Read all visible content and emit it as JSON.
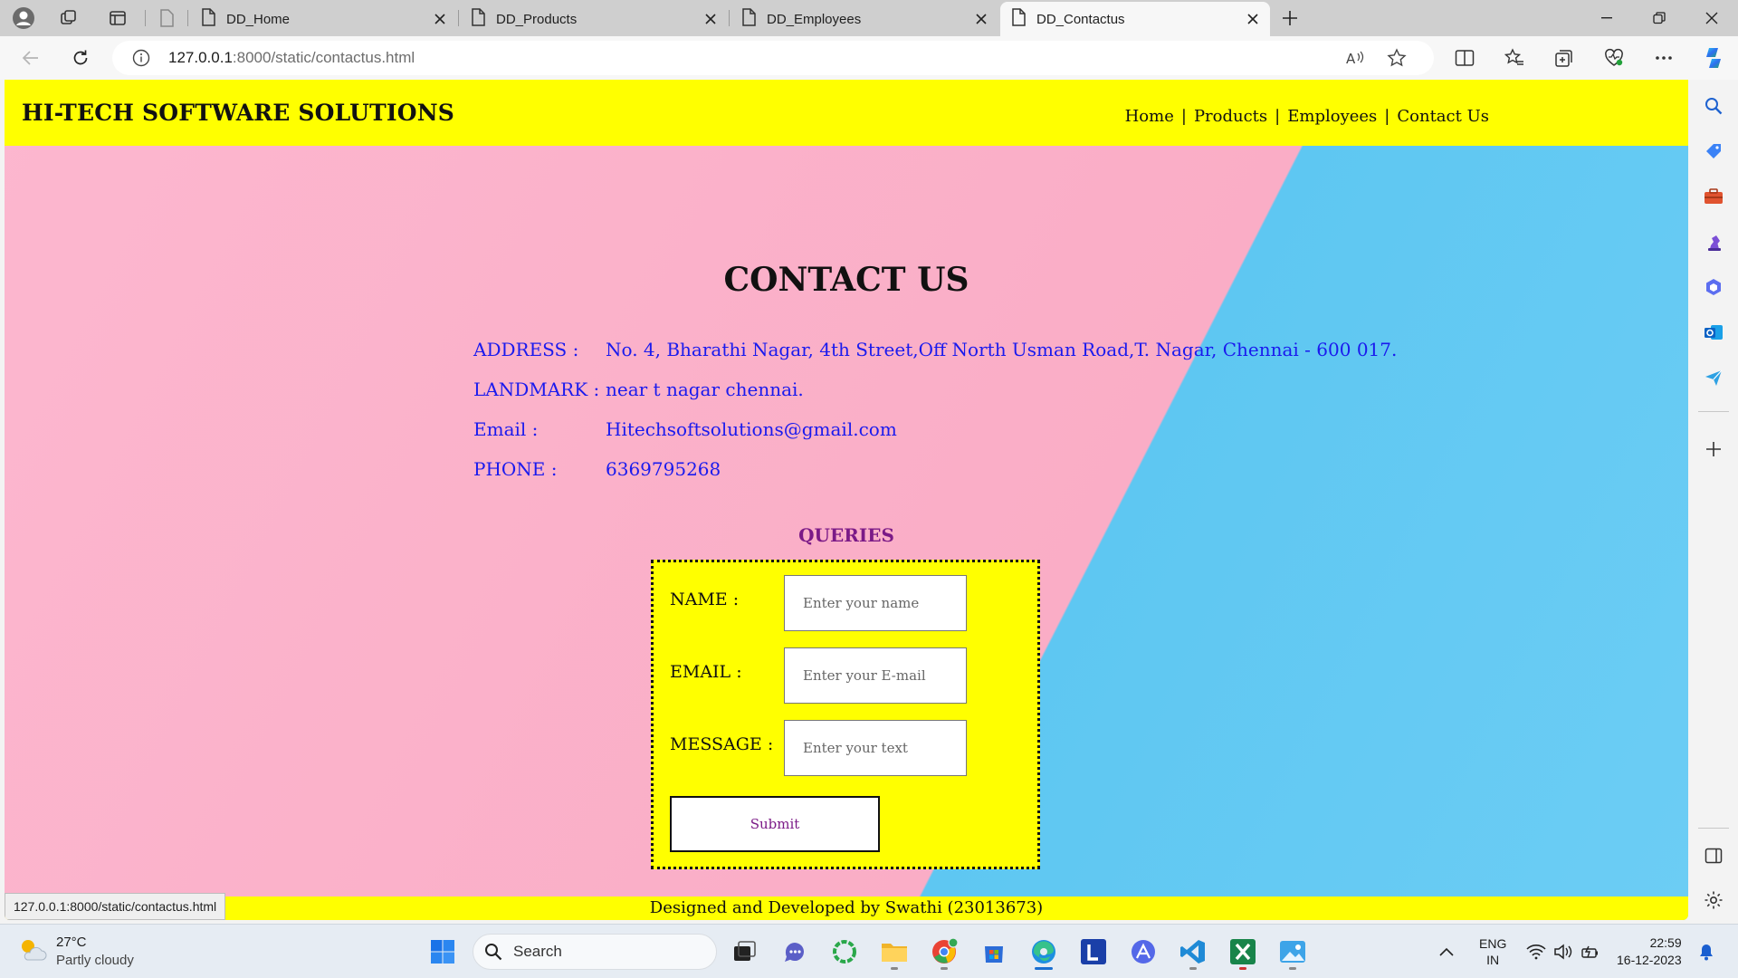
{
  "browser": {
    "tabs": [
      {
        "title": "DD_Home",
        "active": false
      },
      {
        "title": "DD_Products",
        "active": false
      },
      {
        "title": "DD_Employees",
        "active": false
      },
      {
        "title": "DD_Contactus",
        "active": true
      }
    ],
    "url_host": "127.0.0.1",
    "url_rest": ":8000/static/contactus.html",
    "status_url": "127.0.0.1:8000/static/contactus.html"
  },
  "site": {
    "brand": "HI-TECH SOFTWARE SOLUTIONS",
    "nav": {
      "home": "Home",
      "products": "Products",
      "employees": "Employees",
      "contact": "Contact Us",
      "sep": "|"
    },
    "page_title": "CONTACT US",
    "info": [
      {
        "label": "ADDRESS :",
        "value": "No. 4, Bharathi Nagar, 4th Street,Off North Usman Road,T. Nagar, Chennai - 600 017."
      },
      {
        "label": "LANDMARK :",
        "value": "near t nagar chennai."
      },
      {
        "label": "Email :",
        "value": "Hitechsoftsolutions@gmail.com"
      },
      {
        "label": "PHONE :",
        "value": "6369795268"
      }
    ],
    "queries_title": "QUERIES",
    "form": {
      "name_label": "NAME :",
      "name_placeholder": "Enter your name",
      "email_label": "EMAIL :",
      "email_placeholder": "Enter your E-mail",
      "message_label": "MESSAGE :",
      "message_placeholder": "Enter your text",
      "submit": "Submit"
    },
    "footer": "Designed and Developed by Swathi (23013673)",
    "colors": {
      "header_bg": "#ffff00",
      "info_text": "#1a1aee",
      "accent": "#7b1a87",
      "pink": "#fcb7cf",
      "blue": "#6ccdf4"
    }
  },
  "taskbar": {
    "weather_temp": "27°C",
    "weather_desc": "Partly cloudy",
    "search_label": "Search",
    "lang_top": "ENG",
    "lang_bottom": "IN",
    "time": "22:59",
    "date": "16-12-2023"
  }
}
